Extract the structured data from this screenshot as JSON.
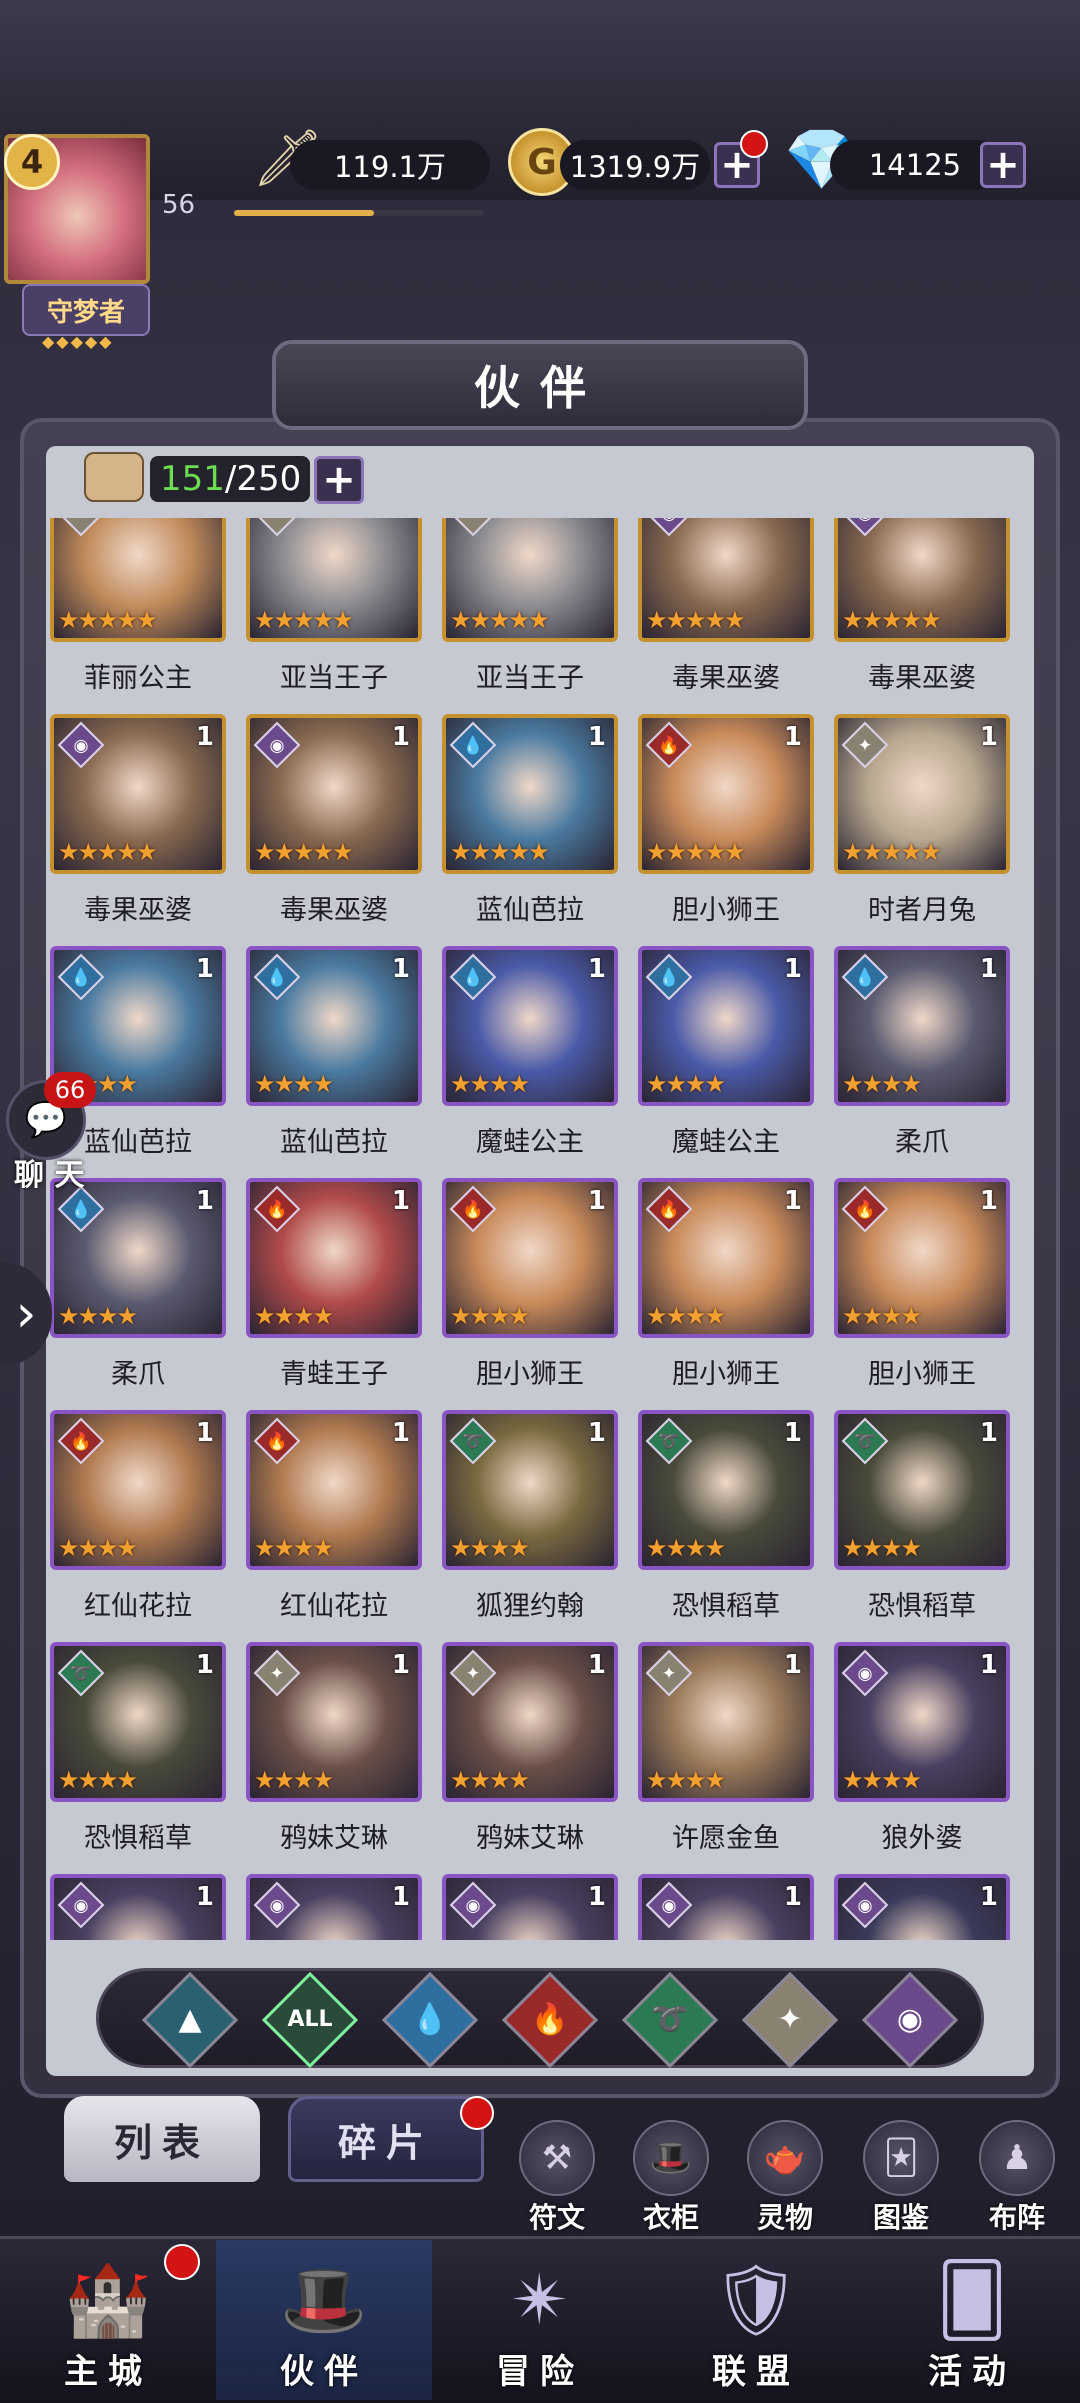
{
  "player": {
    "vip_level": "4",
    "level": "56",
    "title": "守梦者",
    "title_stars": "◆◆◆◆◆"
  },
  "resources": {
    "power": "119.1万",
    "gold": "1319.9万",
    "gems": "14125",
    "gold_symbol": "G",
    "plus": "+"
  },
  "header": {
    "title": "伙伴"
  },
  "roster": {
    "current": "151",
    "max": "/250"
  },
  "elements": {
    "shadow": {
      "icon": "eye-icon",
      "color": "#6a4a8a",
      "glyph": "◉"
    },
    "water": {
      "icon": "water-drop-icon",
      "color": "#2e6fa0",
      "glyph": "💧"
    },
    "fire": {
      "icon": "flame-icon",
      "color": "#9a2a2a",
      "glyph": "🔥"
    },
    "wind": {
      "icon": "wind-icon",
      "color": "#2c7a54",
      "glyph": "➰"
    },
    "light": {
      "icon": "star-icon",
      "color": "#8a8270",
      "glyph": "✦"
    },
    "earth": {
      "icon": "earth-icon",
      "color": "#2a6070",
      "glyph": "▲"
    }
  },
  "heroes": [
    {
      "name": "菲丽公主",
      "level": "",
      "element": "light",
      "stars": 5,
      "frame": "gold",
      "color": "#c08a5a"
    },
    {
      "name": "亚当王子",
      "level": "",
      "element": "light",
      "stars": 5,
      "frame": "gold",
      "color": "#8a8a90"
    },
    {
      "name": "亚当王子",
      "level": "",
      "element": "light",
      "stars": 5,
      "frame": "gold",
      "color": "#8a8a90"
    },
    {
      "name": "毒果巫婆",
      "level": "",
      "element": "shadow",
      "stars": 5,
      "frame": "gold",
      "color": "#8a6a50"
    },
    {
      "name": "毒果巫婆",
      "level": "",
      "element": "shadow",
      "stars": 5,
      "frame": "gold",
      "color": "#8a6a50"
    },
    {
      "name": "毒果巫婆",
      "level": "1",
      "element": "shadow",
      "stars": 5,
      "frame": "gold",
      "color": "#8a6a50"
    },
    {
      "name": "毒果巫婆",
      "level": "1",
      "element": "shadow",
      "stars": 5,
      "frame": "gold",
      "color": "#8a6a50"
    },
    {
      "name": "蓝仙芭拉",
      "level": "1",
      "element": "water",
      "stars": 5,
      "frame": "gold",
      "color": "#4a7aa0"
    },
    {
      "name": "胆小狮王",
      "level": "1",
      "element": "fire",
      "stars": 5,
      "frame": "gold",
      "color": "#c88a5a"
    },
    {
      "name": "时者月兔",
      "level": "1",
      "element": "light",
      "stars": 5,
      "frame": "gold",
      "color": "#b8a890"
    },
    {
      "name": "蓝仙芭拉",
      "level": "1",
      "element": "water",
      "stars": 4,
      "frame": "purple",
      "color": "#4a7aa0"
    },
    {
      "name": "蓝仙芭拉",
      "level": "1",
      "element": "water",
      "stars": 4,
      "frame": "purple",
      "color": "#4a7aa0"
    },
    {
      "name": "魔蛙公主",
      "level": "1",
      "element": "water",
      "stars": 4,
      "frame": "purple",
      "color": "#4a5aa8"
    },
    {
      "name": "魔蛙公主",
      "level": "1",
      "element": "water",
      "stars": 4,
      "frame": "purple",
      "color": "#4a5aa8"
    },
    {
      "name": "柔爪",
      "level": "1",
      "element": "water",
      "stars": 4,
      "frame": "purple",
      "color": "#5a5a70"
    },
    {
      "name": "柔爪",
      "level": "1",
      "element": "water",
      "stars": 4,
      "frame": "purple",
      "color": "#5a5a70"
    },
    {
      "name": "青蛙王子",
      "level": "1",
      "element": "fire",
      "stars": 4,
      "frame": "purple",
      "color": "#b04a4a"
    },
    {
      "name": "胆小狮王",
      "level": "1",
      "element": "fire",
      "stars": 4,
      "frame": "purple",
      "color": "#c88a5a"
    },
    {
      "name": "胆小狮王",
      "level": "1",
      "element": "fire",
      "stars": 4,
      "frame": "purple",
      "color": "#c88a5a"
    },
    {
      "name": "胆小狮王",
      "level": "1",
      "element": "fire",
      "stars": 4,
      "frame": "purple",
      "color": "#c88a5a"
    },
    {
      "name": "红仙花拉",
      "level": "1",
      "element": "fire",
      "stars": 4,
      "frame": "purple",
      "color": "#b07a50"
    },
    {
      "name": "红仙花拉",
      "level": "1",
      "element": "fire",
      "stars": 4,
      "frame": "purple",
      "color": "#b07a50"
    },
    {
      "name": "狐狸约翰",
      "level": "1",
      "element": "wind",
      "stars": 4,
      "frame": "purple",
      "color": "#7a6a40"
    },
    {
      "name": "恐惧稻草",
      "level": "1",
      "element": "wind",
      "stars": 4,
      "frame": "purple",
      "color": "#4a4a3a"
    },
    {
      "name": "恐惧稻草",
      "level": "1",
      "element": "wind",
      "stars": 4,
      "frame": "purple",
      "color": "#4a4a3a"
    },
    {
      "name": "恐惧稻草",
      "level": "1",
      "element": "wind",
      "stars": 4,
      "frame": "purple",
      "color": "#4a4a3a"
    },
    {
      "name": "鸦妹艾琳",
      "level": "1",
      "element": "light",
      "stars": 4,
      "frame": "purple",
      "color": "#6a5048"
    },
    {
      "name": "鸦妹艾琳",
      "level": "1",
      "element": "light",
      "stars": 4,
      "frame": "purple",
      "color": "#6a5048"
    },
    {
      "name": "许愿金鱼",
      "level": "1",
      "element": "light",
      "stars": 4,
      "frame": "purple",
      "color": "#9a7a5a"
    },
    {
      "name": "狼外婆",
      "level": "1",
      "element": "shadow",
      "stars": 4,
      "frame": "purple",
      "color": "#4a4060"
    },
    {
      "name": "",
      "level": "1",
      "element": "shadow",
      "stars": 4,
      "frame": "purple",
      "color": "#4a4060"
    },
    {
      "name": "",
      "level": "1",
      "element": "shadow",
      "stars": 4,
      "frame": "purple",
      "color": "#4a4060"
    },
    {
      "name": "",
      "level": "1",
      "element": "shadow",
      "stars": 4,
      "frame": "purple",
      "color": "#4a4060"
    },
    {
      "name": "",
      "level": "1",
      "element": "shadow",
      "stars": 4,
      "frame": "purple",
      "color": "#4a4060"
    },
    {
      "name": "",
      "level": "1",
      "element": "shadow",
      "stars": 4,
      "frame": "purple",
      "color": "#3a3a5a"
    }
  ],
  "filters": [
    {
      "id": "earth",
      "label": "▲",
      "color": "#2a6070"
    },
    {
      "id": "all",
      "label": "ALL",
      "color": "#2a4a3a"
    },
    {
      "id": "water",
      "label": "💧",
      "color": "#2e6fa0"
    },
    {
      "id": "fire",
      "label": "🔥",
      "color": "#9a2a2a"
    },
    {
      "id": "wind",
      "label": "➰",
      "color": "#2c7a54"
    },
    {
      "id": "light",
      "label": "✦",
      "color": "#8a8270"
    },
    {
      "id": "shadow",
      "label": "◉",
      "color": "#6a4a8a"
    }
  ],
  "subtabs": {
    "list": "列表",
    "fragments": "碎片"
  },
  "tools": [
    {
      "label": "符文",
      "icon": "rune-icon",
      "glyph": "⚒"
    },
    {
      "label": "衣柜",
      "icon": "wardrobe-icon",
      "glyph": "🎩"
    },
    {
      "label": "灵物",
      "icon": "spirit-icon",
      "glyph": "🫖"
    },
    {
      "label": "图鉴",
      "icon": "codex-icon",
      "glyph": "🃏"
    },
    {
      "label": "布阵",
      "icon": "formation-icon",
      "glyph": "♟"
    }
  ],
  "nav": [
    {
      "label": "主城",
      "icon": "castle-icon",
      "glyph": "🏰"
    },
    {
      "label": "伙伴",
      "icon": "witch-hat-icon",
      "glyph": "🎩"
    },
    {
      "label": "冒险",
      "icon": "compass-icon",
      "glyph": "✴"
    },
    {
      "label": "联盟",
      "icon": "shield-icon",
      "glyph": "🛡"
    },
    {
      "label": "活动",
      "icon": "cards-icon",
      "glyph": "🂠"
    }
  ],
  "chat": {
    "count": "66",
    "label": "聊 天",
    "glyph": "💬"
  },
  "side": {
    "arrow": "›"
  }
}
